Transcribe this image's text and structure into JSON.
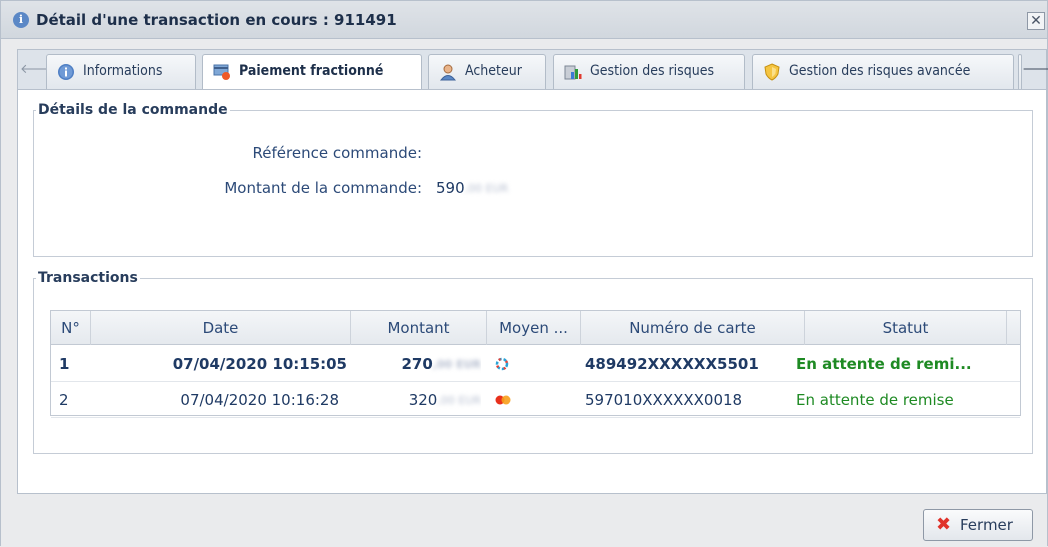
{
  "window": {
    "title": "Détail d'une transaction en cours : 911491",
    "close_glyph": "✕"
  },
  "tabs": [
    {
      "label": "Informations",
      "icon": "info-icon"
    },
    {
      "label": "Paiement fractionné",
      "icon": "split-payment-icon",
      "active": true
    },
    {
      "label": "Acheteur",
      "icon": "user-icon"
    },
    {
      "label": "Gestion des risques",
      "icon": "risk-chart-icon"
    },
    {
      "label": "Gestion des risques avancée",
      "icon": "shield-icon"
    }
  ],
  "order": {
    "legend": "Détails de la commande",
    "reference_label": "Référence commande:",
    "reference_value": "",
    "amount_label": "Montant de la commande:",
    "amount_value": "590",
    "amount_blurred": ",00 EUR"
  },
  "transactions": {
    "legend": "Transactions",
    "columns": [
      "N°",
      "Date",
      "Montant",
      "Moyen ...",
      "Numéro de carte",
      "Statut"
    ],
    "rows": [
      {
        "no": "1",
        "date": "07/04/2020 10:15:05",
        "amount": "270",
        "amount_blurred": ",00 EUR",
        "payment_icon": "cb-card-icon",
        "card": "489492XXXXXX5501",
        "status": "En attente de remi..."
      },
      {
        "no": "2",
        "date": "07/04/2020 10:16:28",
        "amount": "320",
        "amount_blurred": ",00 EUR",
        "payment_icon": "mastercard-icon",
        "card": "597010XXXXXX0018",
        "status": "En attente de remise"
      }
    ]
  },
  "footer": {
    "close_label": "Fermer"
  },
  "colors": {
    "status_green": "#1e8a23",
    "header_bg": "#d1d7de",
    "accent_blue": "#5b88c6"
  }
}
